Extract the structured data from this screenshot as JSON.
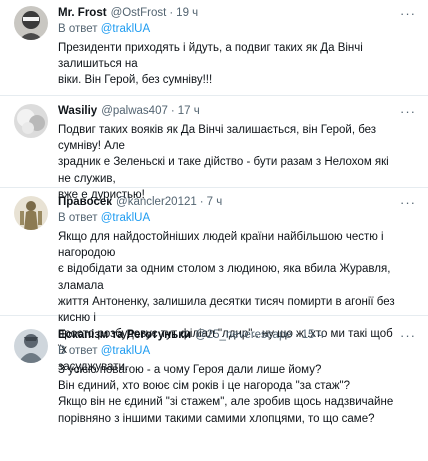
{
  "common": {
    "reply_prefix": "В ответ",
    "dot": "·",
    "more": "···"
  },
  "tweets": [
    {
      "name": "Mr. Frost",
      "handle": "@OstFrost",
      "time": "19 ч",
      "reply_to": "@traklUA",
      "text": "Президенти приходять і йдуть, а подвиг таких як Да Вінчі залишиться на\nвіки. Він Герой, без сумніву!!!"
    },
    {
      "name": "Wasiliy",
      "handle": "@palwas407",
      "time": "17 ч",
      "reply_to": "",
      "text": "Подвиг таких вояків як Да Вінчі залишається, він Герой, без сумніву! Але\nзрадник е Зеленьскі и таке дійство - бути разам з Нелохом які не служив,\nвже е дуристью!"
    },
    {
      "name": "Правосек",
      "handle": "@kancler20121",
      "time": "7 ч",
      "reply_to": "@traklUA",
      "text": "Якщо для найдостойніших людей країни найбільшою честю і нагородою\nє відобідати за одним столом з людиною, яка вбила Журавля, зламала\nжиття Антоненку, залишила десятки тисяч помирти в агонії без кисню і\nпросто розбудовує тут філіал \"лднр\".. ну що ж..хто ми такі щоб їх\nзасуджувати."
    },
    {
      "name": "Ескапізм та Реготуньки",
      "handle": "@25_neverescape",
      "time": "15 ч",
      "reply_to": "@traklUA",
      "text": "З усією повагою - а чому Героя дали лише йому?\nВін єдиний, хто воює сім років і це нагорода \"за стаж\"?\nЯкщо він не єдиний \"зі стажем\", але зробив щось надзвичайне\nпорівняно з іншими такими самими хлопцями, то що саме?"
    }
  ]
}
